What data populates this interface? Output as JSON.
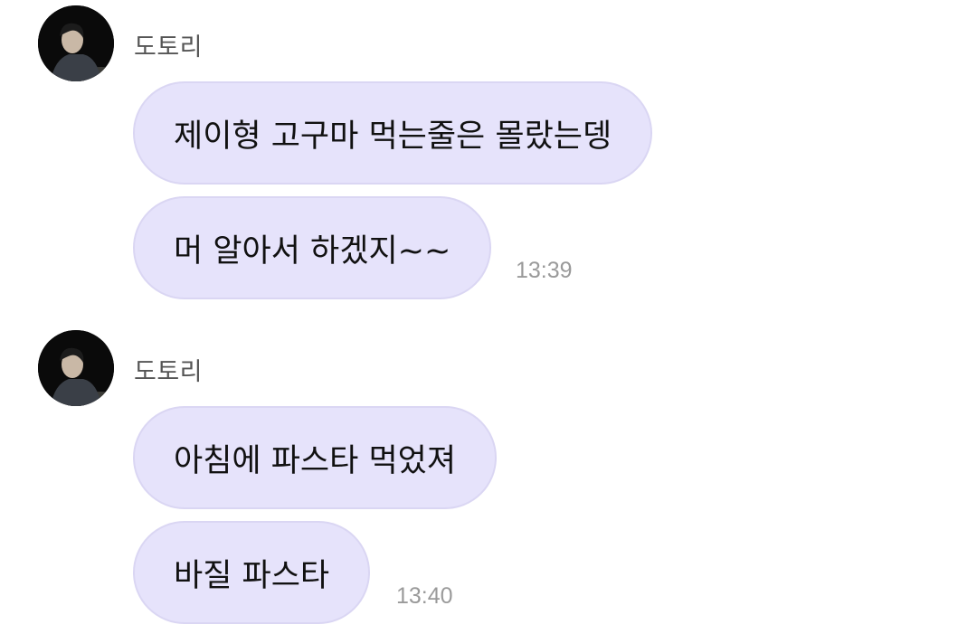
{
  "messages": [
    {
      "sender": "도토리",
      "bubbles": [
        "제이형 고구마 먹는줄은 몰랐는뎅",
        "머 알아서 하겠지~~"
      ],
      "time": "13:39"
    },
    {
      "sender": "도토리",
      "bubbles": [
        "아침에 파스타 먹었져",
        "바질 파스타"
      ],
      "time": "13:40"
    }
  ],
  "colors": {
    "bubble_bg": "#e6e3fb",
    "bubble_border": "#dad6f3",
    "sender_text": "#555555",
    "time_text": "#9a9a9a"
  }
}
